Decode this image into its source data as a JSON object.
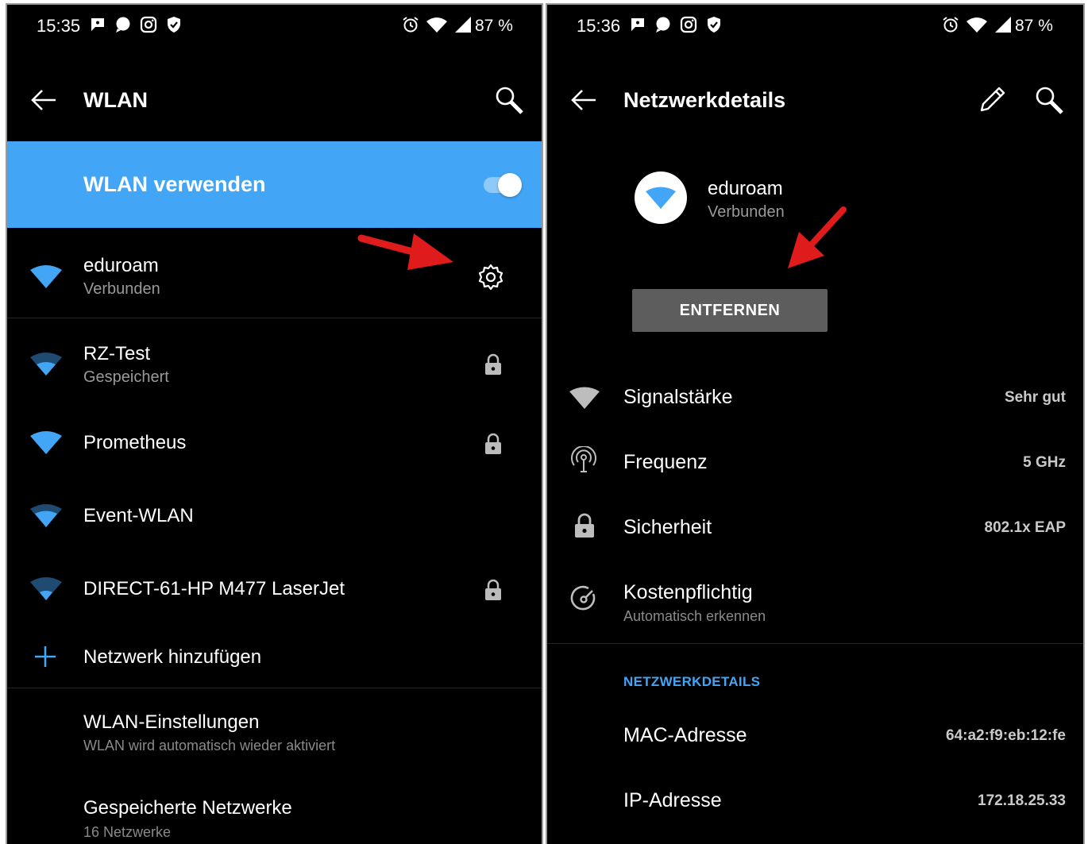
{
  "left": {
    "status": {
      "time": "15:35",
      "battery": "87 %"
    },
    "header": {
      "title": "WLAN"
    },
    "toggle_row": {
      "label": "WLAN verwenden",
      "checked": true
    },
    "networks": [
      {
        "name": "eduroam",
        "status": "Verbunden",
        "icon": "wifi-icon",
        "locked": false,
        "settings": true
      },
      {
        "name": "RZ-Test",
        "status": "Gespeichert",
        "icon": "wifi-icon",
        "locked": true
      },
      {
        "name": "Prometheus",
        "status": "",
        "icon": "wifi-icon",
        "locked": true
      },
      {
        "name": "Event-WLAN",
        "status": "",
        "icon": "wifi-icon",
        "locked": false
      },
      {
        "name": "DIRECT-61-HP M477 LaserJet",
        "status": "",
        "icon": "wifi-icon",
        "locked": true
      }
    ],
    "add_network": "Netzwerk hinzufügen",
    "settings": [
      {
        "title": "WLAN-Einstellungen",
        "sub": "WLAN wird automatisch wieder aktiviert"
      },
      {
        "title": "Gespeicherte Netzwerke",
        "sub": "16 Netzwerke"
      }
    ]
  },
  "right": {
    "status": {
      "time": "15:36",
      "battery": "87 %"
    },
    "header": {
      "title": "Netzwerkdetails"
    },
    "network": {
      "name": "eduroam",
      "status": "Verbunden"
    },
    "remove_button": "ENTFERNEN",
    "details": [
      {
        "label": "Signalstärke",
        "value": "Sehr gut",
        "icon": "signal-icon"
      },
      {
        "label": "Frequenz",
        "value": "5 GHz",
        "icon": "antenna-icon"
      },
      {
        "label": "Sicherheit",
        "value": "802.1x EAP",
        "icon": "lock-icon"
      },
      {
        "label": "Kostenpflichtig",
        "sub": "Automatisch erkennen",
        "icon": "metered-icon"
      }
    ],
    "section_title": "NETZWERKDETAILS",
    "net_details": [
      {
        "label": "MAC-Adresse",
        "value": "64:a2:f9:eb:12:fe"
      },
      {
        "label": "IP-Adresse",
        "value": "172.18.25.33"
      }
    ]
  },
  "colors": {
    "accent": "#42a5f5",
    "background": "#000000",
    "arrow": "#e01b1b",
    "button": "#5d5d5d"
  }
}
